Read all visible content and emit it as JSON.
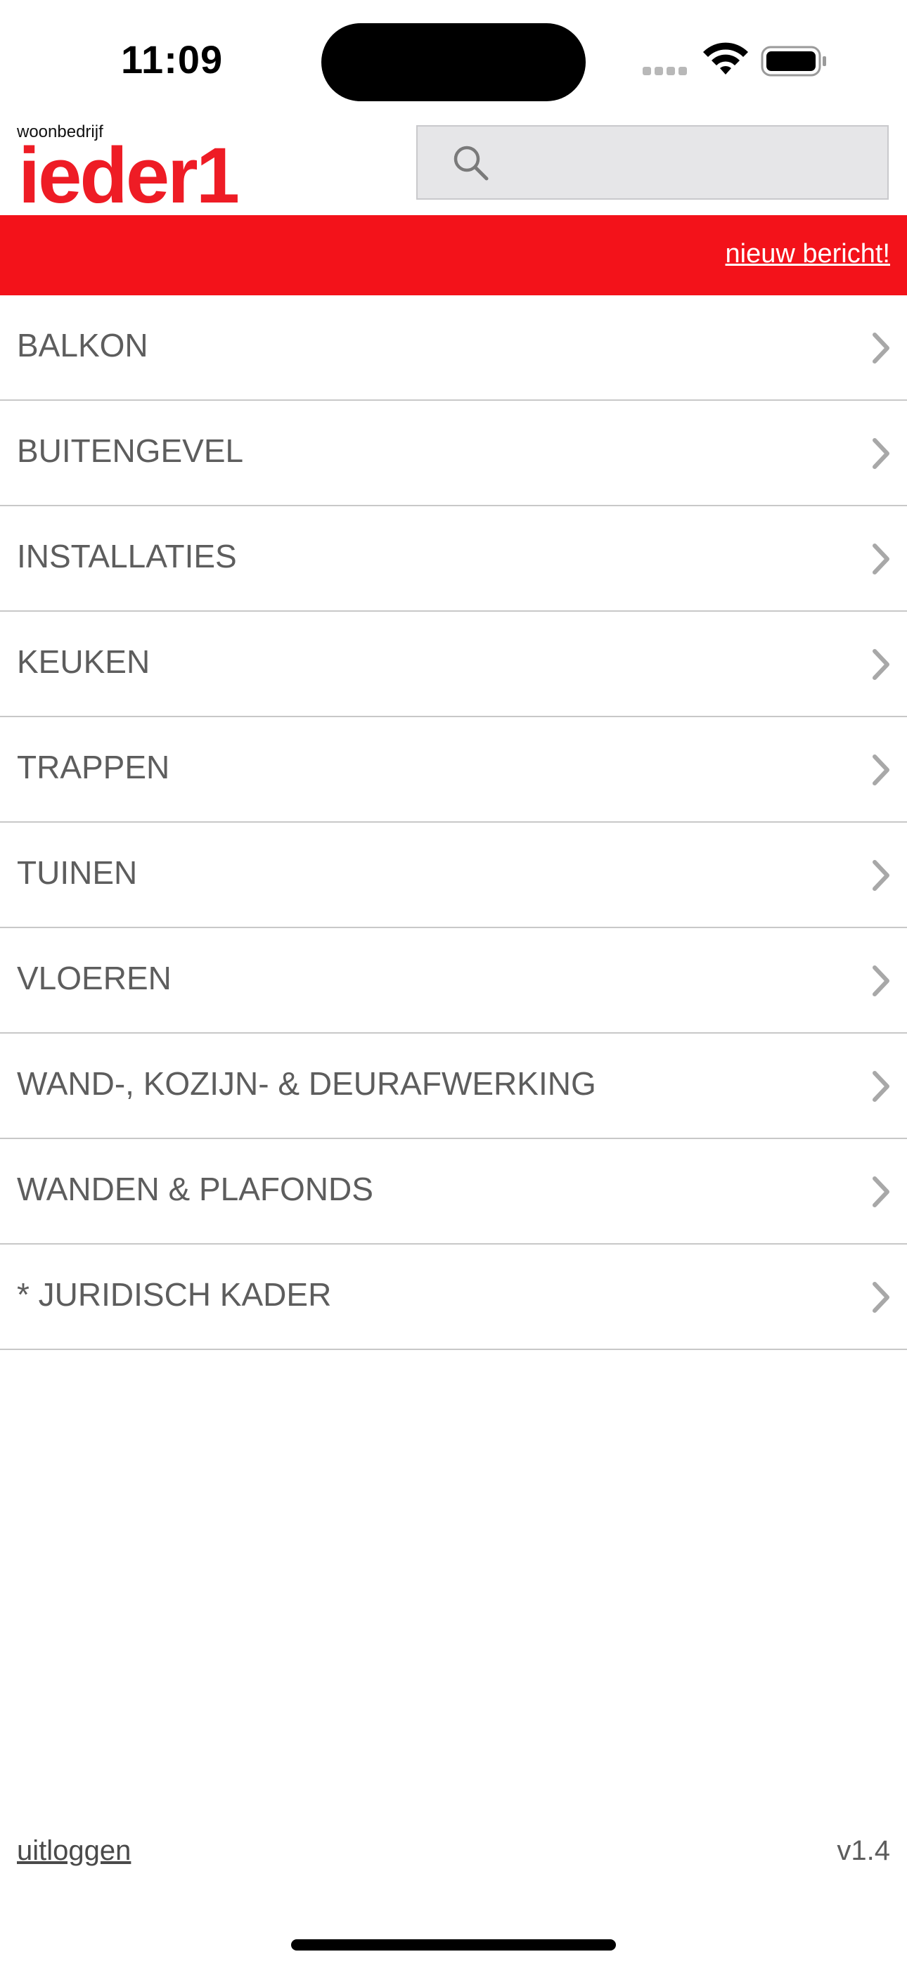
{
  "status_bar": {
    "time": "11:09",
    "icons": [
      "signal-icon",
      "wifi-icon",
      "battery-icon"
    ]
  },
  "header": {
    "logo_small": "woonbedrijf",
    "logo_big": "ieder1",
    "search": {
      "placeholder": "",
      "value": "",
      "icon": "search-icon"
    }
  },
  "banner": {
    "link_label": "nieuw bericht!",
    "color": "#f3121a"
  },
  "menu": {
    "items": [
      {
        "label": "BALKON"
      },
      {
        "label": "BUITENGEVEL"
      },
      {
        "label": "INSTALLATIES"
      },
      {
        "label": "KEUKEN"
      },
      {
        "label": "TRAPPEN"
      },
      {
        "label": "TUINEN"
      },
      {
        "label": "VLOEREN"
      },
      {
        "label": "WAND-, KOZIJN- & DEURAFWERKING"
      },
      {
        "label": "WANDEN & PLAFONDS"
      },
      {
        "label": "* JURIDISCH KADER"
      }
    ],
    "chevron_icon": "chevron-right-icon"
  },
  "footer": {
    "logout_label": "uitloggen",
    "version": "v1.4"
  },
  "colors": {
    "brand_red": "#ee1c25",
    "text_gray": "#5d5d5d",
    "divider": "#c8c8c8"
  }
}
